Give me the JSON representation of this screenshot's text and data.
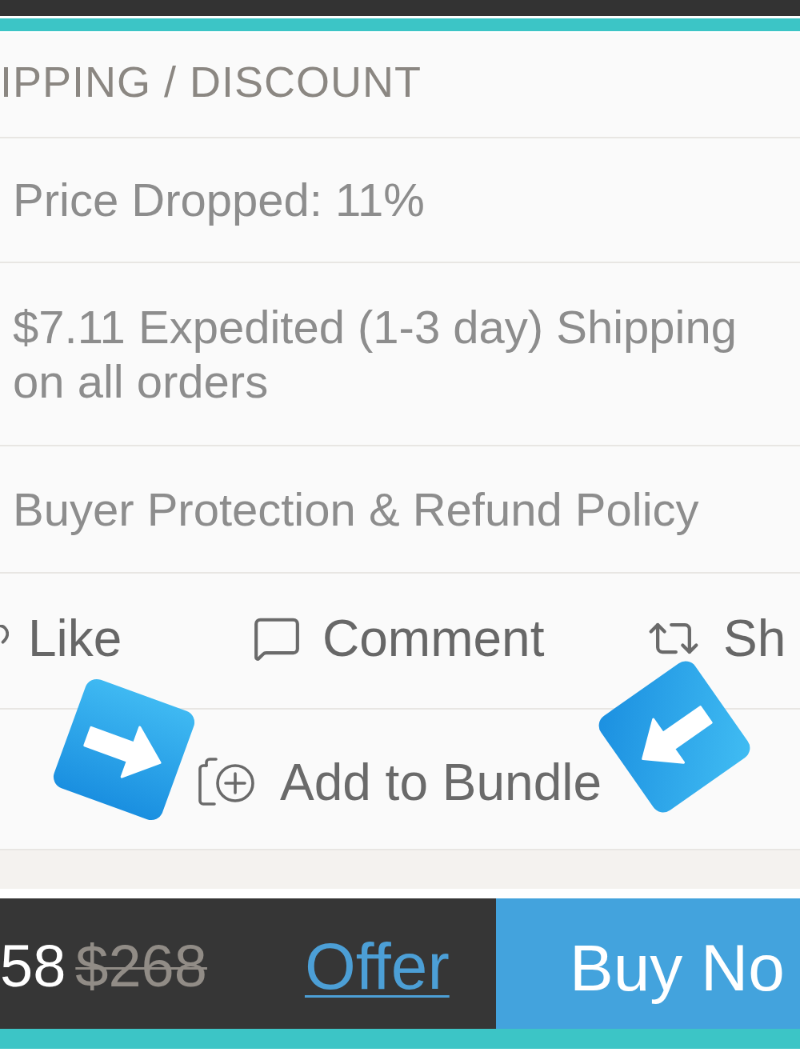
{
  "section": {
    "title": "IPPING / DISCOUNT",
    "rows": [
      {
        "text": "Price Dropped: 11%"
      },
      {
        "text": "$7.11 Expedited (1-3 day) Shipping on all orders"
      },
      {
        "text": "Buyer Protection & Refund Policy"
      }
    ]
  },
  "actions": [
    {
      "kind": "like",
      "label": "Like"
    },
    {
      "kind": "comment",
      "label": "Comment"
    },
    {
      "kind": "share",
      "label": "Sh"
    }
  ],
  "bundle_button": {
    "label": "Add to Bundle"
  },
  "overlay_arrows": [
    {
      "kind": "right"
    },
    {
      "kind": "left"
    }
  ],
  "purchase_bar": {
    "price": "58",
    "original_price": "$268",
    "offer_link": "Offer",
    "buy_button": "Buy No"
  }
}
